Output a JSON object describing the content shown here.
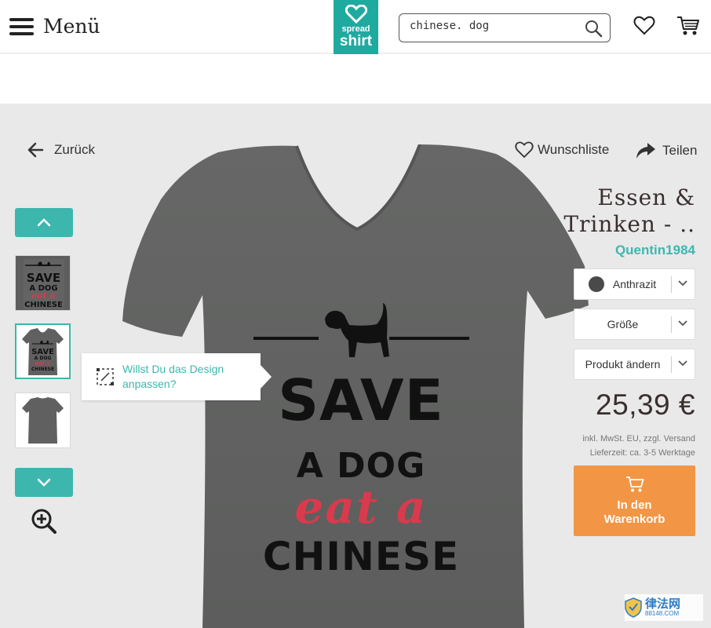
{
  "header": {
    "menu_label": "Menü",
    "logo_line1": "spread",
    "logo_line2": "shirt",
    "search_value": "chinese. dog"
  },
  "nav": {
    "back_label": "Zurück",
    "wishlist_label": "Wunschliste",
    "share_label": "Teilen"
  },
  "thumbnails": [
    {
      "name": "design-view"
    },
    {
      "name": "front-view",
      "active": true
    },
    {
      "name": "back-view"
    }
  ],
  "design": {
    "line1": "SAVE",
    "line2": "A DOG",
    "line3": "eat a",
    "line4": "CHINESE"
  },
  "thumb_design": {
    "line1": "SAVE",
    "line2": "A DOG",
    "line3": "eat a",
    "line4": "CHINESE"
  },
  "tooltip": {
    "text": "Willst Du das Design anpassen?"
  },
  "product": {
    "title": "Essen & Trinken - ..",
    "designer": "Quentin1984",
    "color_label": "Anthrazit",
    "size_label": "Größe",
    "change_label": "Produkt ändern",
    "price": "25,39 €",
    "vat_line1": "inkl. MwSt. EU, zzgl. Versand",
    "vat_line2": "Lieferzeit: ca. 3-5 Werktage",
    "cart_label": "In den\nWarenkorb"
  },
  "watermark": {
    "text": "律法网",
    "sub": "88148.COM"
  },
  "colors": {
    "accent": "#3db7ae",
    "logo_bg": "#1faaa0",
    "cart_button": "#f29645",
    "shirt": "#5f605f",
    "design_red": "#d93a4d",
    "swatch": "#4a4a4a"
  }
}
